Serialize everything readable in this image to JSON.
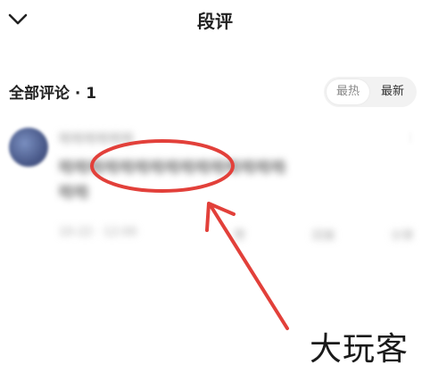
{
  "header": {
    "title": "段评"
  },
  "comments_section": {
    "title": "全部评论 · 1",
    "sort": {
      "options": [
        "最热",
        "最新"
      ]
    }
  },
  "comment": {
    "username": "哈哈哈哈哈哈",
    "body_line1": "哈哈哈哈哈哈哈哈哈哈哈哈哈哈哈",
    "body_line2": "哈哈",
    "meta": "10-22 · 12:00",
    "likes": "赞",
    "replies": "回复",
    "share": "分享"
  },
  "watermark": "大玩客",
  "colors": {
    "annotation_red": "#e2403a",
    "toggle_bg": "#f2f2f2"
  }
}
